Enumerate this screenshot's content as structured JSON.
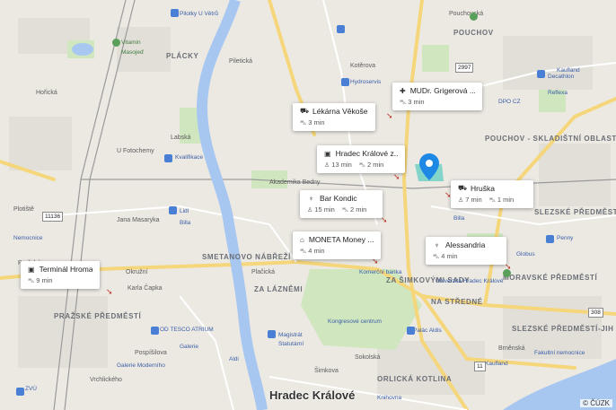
{
  "map": {
    "city": "Hradec Králové",
    "copyright": "© ČÚZK",
    "districts": [
      "PLÁCKY",
      "POUCHOV",
      "POUCHOV - SKLADIŠTNÍ OBLAST",
      "SMETANOVO NÁBŘEŽÍ",
      "ZA ŠIMKOVÝMI SADY",
      "NA STŘEDNÉ",
      "SLEZSKÉ PŘEDMĚSTÍ-STŘED",
      "SLEZSKÉ PŘEDMĚSTÍ-JIH",
      "PRAŽSKÉ PŘEDMĚSTÍ",
      "ORLICKÁ KOTLINA",
      "MORAVSKÉ PŘEDMĚSTÍ",
      "ZA LÁZNĚMI"
    ],
    "streets": [
      "Plotiště",
      "Pražská",
      "Plačická",
      "Okružní",
      "Jana Masaryka",
      "Pouchovská",
      "Akademika Bedny",
      "Karla Čapka",
      "U Fotochemy",
      "Pospíšilova",
      "Piletická",
      "Kotěrova",
      "Brněnská",
      "Sokolská",
      "Labská",
      "Šimkova",
      "Vrchlického",
      "Hořická"
    ],
    "pois": [
      "Pilotky U Větrů",
      "Vitamin",
      "Masojeď",
      "Hydroservis",
      "Decathlon",
      "Reflexa",
      "Kvalifikace",
      "Lidl",
      "Billa",
      "Nemocnice",
      "Penny",
      "Globus",
      "Kaufland",
      "Fakultní nemocnice",
      "OD TESCO ATRIUM",
      "Galerie Moderního",
      "Magistrát",
      "Statutární",
      "Aldi",
      "Galerie",
      "Knihovna",
      "Kongresové centrum",
      "Palác Aldis",
      "Univerzita Hradec Králové",
      "Komerční banka",
      "ZVÚ",
      "DPO CZ",
      "Kaufland",
      "Billa"
    ],
    "roads": [
      "2997",
      "11136",
      "308",
      "11"
    ],
    "pin_color": "#1e88e5",
    "water_color": "#a8c7f0",
    "park_color": "#c9e4b8"
  },
  "cards": [
    {
      "name": "MUDr. Grigerová ...",
      "icon": "medical-icon",
      "icon_char": "✚",
      "meta": [
        {
          "icon": "car-icon",
          "icon_char": "⛍",
          "text": "3 min"
        }
      ]
    },
    {
      "name": "Lékárna Věkoše",
      "icon": "shop-icon",
      "icon_char": "⛟",
      "meta": [
        {
          "icon": "car-icon",
          "icon_char": "⛍",
          "text": "3 min"
        }
      ]
    },
    {
      "name": "Hradec Králové z...",
      "icon": "bus-icon",
      "icon_char": "▣",
      "meta": [
        {
          "icon": "walk-icon",
          "icon_char": "♙",
          "text": "13 min"
        },
        {
          "icon": "car-icon",
          "icon_char": "⛍",
          "text": "2 min"
        }
      ]
    },
    {
      "name": "Hruška",
      "icon": "shop-icon",
      "icon_char": "⛟",
      "meta": [
        {
          "icon": "walk-icon",
          "icon_char": "♙",
          "text": "7 min"
        },
        {
          "icon": "car-icon",
          "icon_char": "⛍",
          "text": "1 min"
        }
      ]
    },
    {
      "name": "Bar Kondic",
      "icon": "restaurant-icon",
      "icon_char": "♆",
      "meta": [
        {
          "icon": "walk-icon",
          "icon_char": "♙",
          "text": "15 min"
        },
        {
          "icon": "car-icon",
          "icon_char": "⛍",
          "text": "2 min"
        }
      ]
    },
    {
      "name": "MONETA Money ...",
      "icon": "bank-icon",
      "icon_char": "⌂",
      "meta": [
        {
          "icon": "car-icon",
          "icon_char": "⛍",
          "text": "4 min"
        }
      ]
    },
    {
      "name": "Alessandria",
      "icon": "restaurant-icon",
      "icon_char": "♆",
      "meta": [
        {
          "icon": "car-icon",
          "icon_char": "⛍",
          "text": "4 min"
        }
      ]
    },
    {
      "name": "Terminál Hromad...",
      "icon": "bus-icon",
      "icon_char": "▣",
      "meta": [
        {
          "icon": "car-icon",
          "icon_char": "⛍",
          "text": "9 min"
        }
      ]
    }
  ]
}
